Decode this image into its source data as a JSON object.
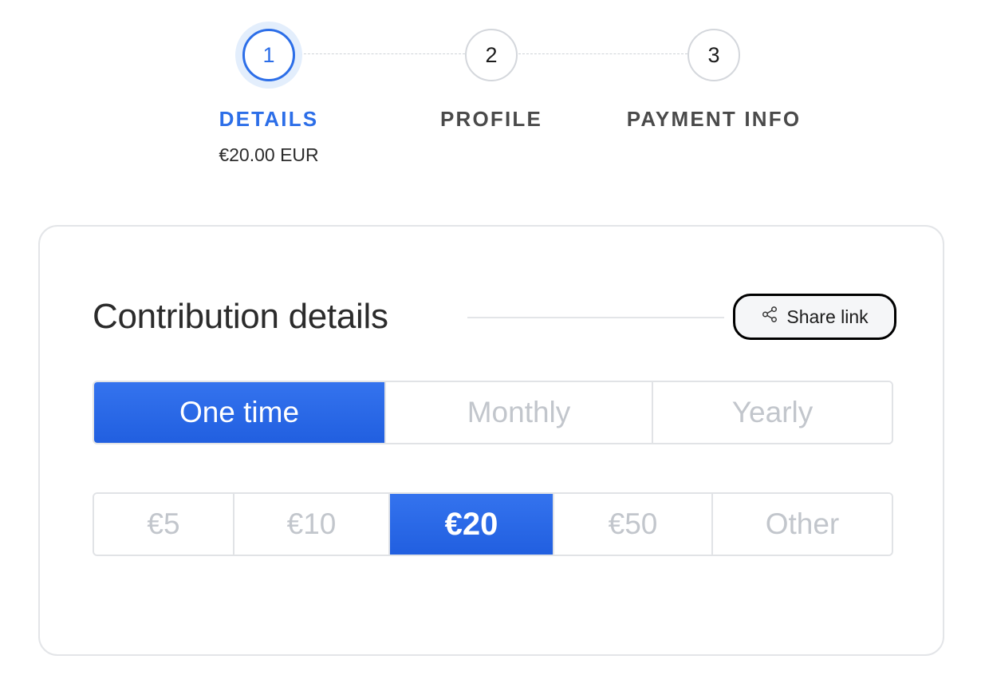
{
  "stepper": {
    "steps": [
      {
        "number": "1",
        "label": "DETAILS",
        "sub": "€20.00 EUR",
        "state": "active"
      },
      {
        "number": "2",
        "label": "PROFILE",
        "sub": "",
        "state": "inactive"
      },
      {
        "number": "3",
        "label": "PAYMENT INFO",
        "sub": "",
        "state": "inactive"
      }
    ]
  },
  "card": {
    "title": "Contribution details",
    "share_label": "Share link",
    "share_icon": "share-icon",
    "frequency": {
      "options": [
        "One time",
        "Monthly",
        "Yearly"
      ],
      "selected": "One time"
    },
    "amounts": {
      "options": [
        "€5",
        "€10",
        "€20",
        "€50",
        "Other"
      ],
      "selected": "€20"
    }
  },
  "colors": {
    "accent": "#2c6ee8",
    "accent_glow": "#e3eefc",
    "muted_text": "#c2c6cc",
    "border": "#e1e3e6"
  }
}
